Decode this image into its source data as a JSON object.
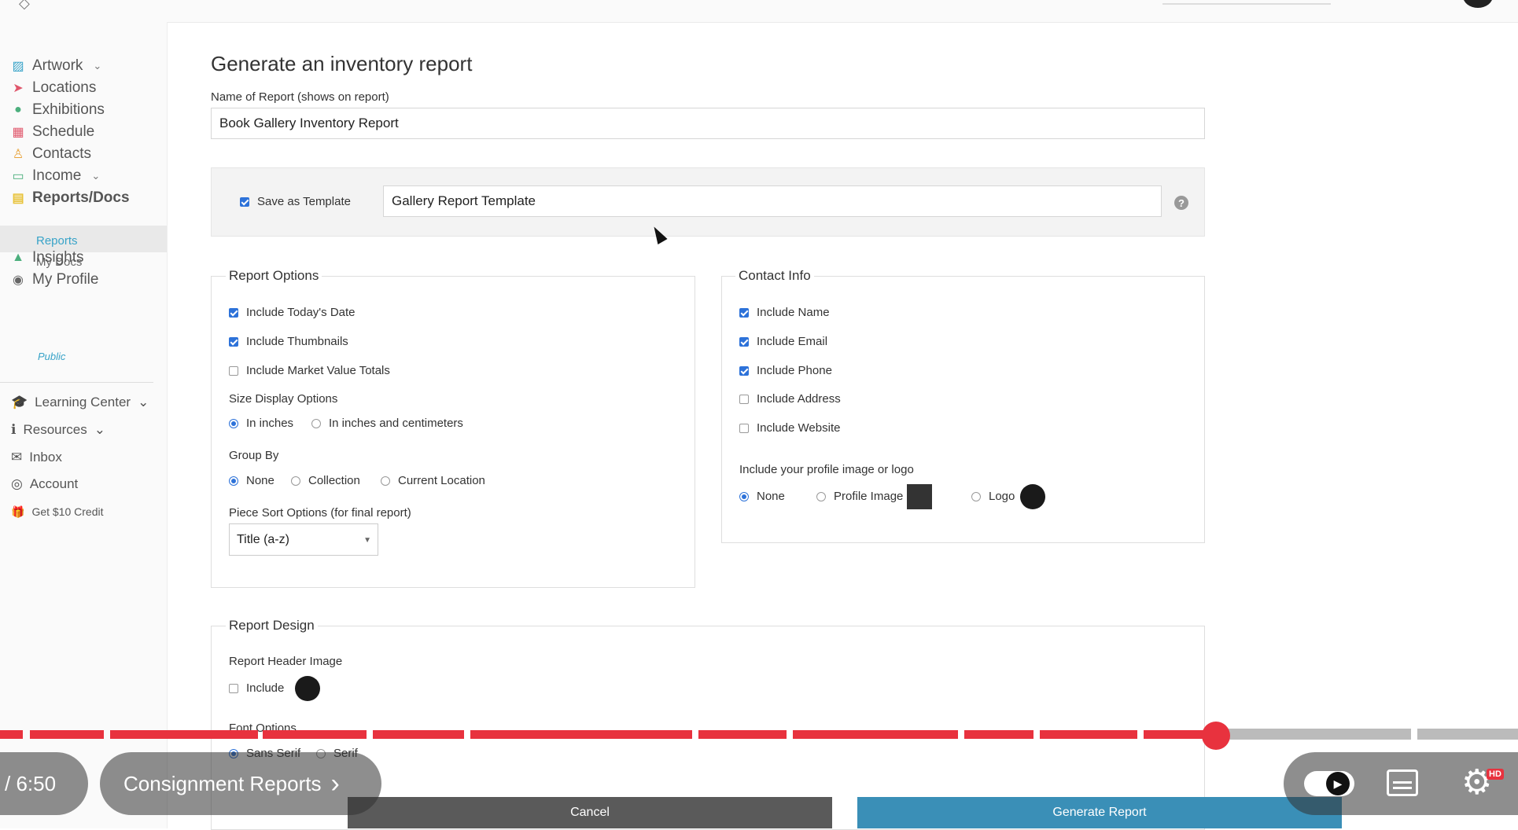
{
  "colors": {
    "accent": "#38a3c8",
    "checkbox": "#2d72d9",
    "progress": "#e8323e",
    "generate_button": "#3a8fb7",
    "cancel_button": "#5a5a5a"
  },
  "sidebar": {
    "items": [
      {
        "label": "Artwork",
        "icon": "image-icon"
      },
      {
        "label": "Locations",
        "icon": "location-arrow-icon"
      },
      {
        "label": "Exhibitions",
        "icon": "map-pin-icon"
      },
      {
        "label": "Schedule",
        "icon": "calendar-icon"
      },
      {
        "label": "Contacts",
        "icon": "person-icon"
      },
      {
        "label": "Income",
        "icon": "money-icon"
      },
      {
        "label": "Reports/Docs",
        "icon": "document-icon"
      },
      {
        "label": "Insights",
        "icon": "chart-icon"
      },
      {
        "label": "My Profile",
        "icon": "globe-icon"
      }
    ],
    "sub_reports": "Reports",
    "sub_mydocs": "My Docs",
    "public": "Public",
    "secondary": [
      {
        "label": "Learning Center",
        "icon": "graduation-cap-icon"
      },
      {
        "label": "Resources",
        "icon": "info-icon"
      },
      {
        "label": "Inbox",
        "icon": "envelope-icon"
      },
      {
        "label": "Account",
        "icon": "user-circle-icon"
      },
      {
        "label": "Get $10 Credit",
        "icon": "gift-icon"
      }
    ]
  },
  "main": {
    "title": "Generate an inventory report",
    "name_label": "Name of Report (shows on report)",
    "name_value": "Book Gallery Inventory Report",
    "save_template_label": "Save as Template",
    "template_value": "Gallery Report Template",
    "help": "?"
  },
  "report_options": {
    "title": "Report Options",
    "include_date": "Include Today's Date",
    "include_thumbnails": "Include Thumbnails",
    "include_market": "Include Market Value Totals",
    "size_title": "Size Display Options",
    "size_inches": "In inches",
    "size_both": "In inches and centimeters",
    "group_title": "Group By",
    "group_none": "None",
    "group_collection": "Collection",
    "group_location": "Current Location",
    "sort_title": "Piece Sort Options (for final report)",
    "sort_value": "Title (a-z)"
  },
  "contact_info": {
    "title": "Contact Info",
    "include_name": "Include Name",
    "include_email": "Include Email",
    "include_phone": "Include Phone",
    "include_address": "Include Address",
    "include_website": "Include Website",
    "image_title": "Include your profile image or logo",
    "opt_none": "None",
    "opt_profile": "Profile Image",
    "opt_logo": "Logo"
  },
  "report_design": {
    "title": "Report Design",
    "header_title": "Report Header Image",
    "include": "Include",
    "font_title": "Font Options",
    "sans": "Sans Serif",
    "serif": "Serif"
  },
  "footer": {
    "cancel": "Cancel",
    "generate": "Generate Report"
  },
  "video": {
    "time": "/ 6:50",
    "chapter": "Consignment Reports",
    "chapter_chevron": "›",
    "hd": "HD",
    "played_fraction": 0.8
  }
}
